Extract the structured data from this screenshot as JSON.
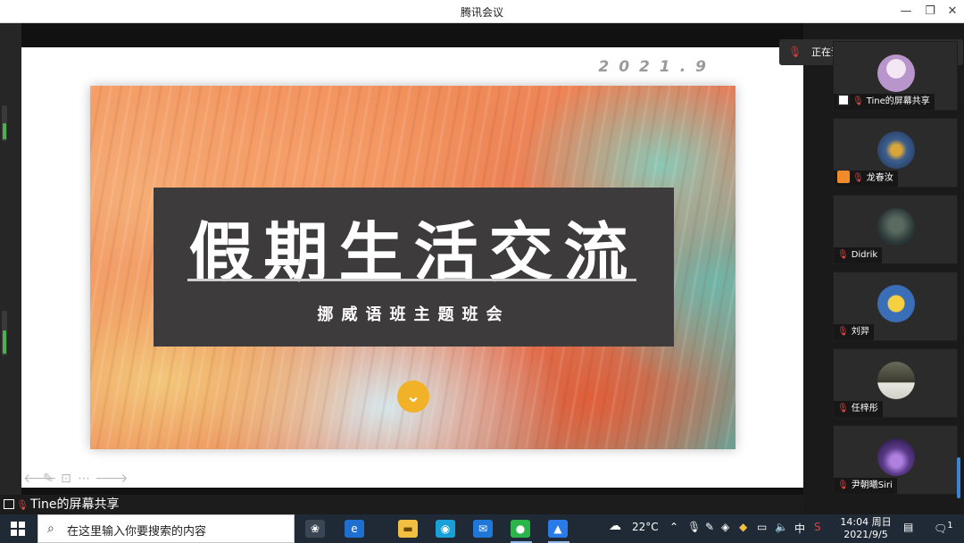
{
  "window": {
    "title": "腾讯会议",
    "minimize": "—",
    "restore": "❐",
    "close": "✕"
  },
  "slide": {
    "date": "2021.9",
    "title": "假期生活交流",
    "subtitle": "挪威语班主题班会",
    "down_glyph": "⌄"
  },
  "slide_tools": [
    "🡐",
    "✎",
    "⊡",
    "⋯",
    "🡒"
  ],
  "share_label": "Tine的屏幕共享",
  "speaking": {
    "label": "正在讲话:"
  },
  "participants": [
    {
      "name": "Tine的屏幕共享",
      "badge": "screen",
      "avatar_color": "#c9a7d6"
    },
    {
      "name": "龙春汝",
      "badge": "orange-user",
      "avatar_color": "#3c5f8f"
    },
    {
      "name": "Didrik",
      "badge": "",
      "avatar_color": "#2e3b3a"
    },
    {
      "name": "刘羿",
      "badge": "",
      "avatar_color": "#f0c040"
    },
    {
      "name": "任梓彤",
      "badge": "",
      "avatar_color": "#4a4a3a"
    },
    {
      "name": "尹朝曦Siri",
      "badge": "",
      "avatar_color": "#5a3a8a"
    }
  ],
  "taskbar": {
    "search_placeholder": "在这里输入你要搜索的内容",
    "weather": "22°C",
    "ime": "中",
    "time": "14:04 周日",
    "date": "2021/9/5",
    "notification_count": "1"
  },
  "colors": {
    "banner": "#3d3b3c",
    "accent_yellow": "#f1b228",
    "taskbar": "#1f2a36",
    "panel": "#1a1a1a"
  }
}
